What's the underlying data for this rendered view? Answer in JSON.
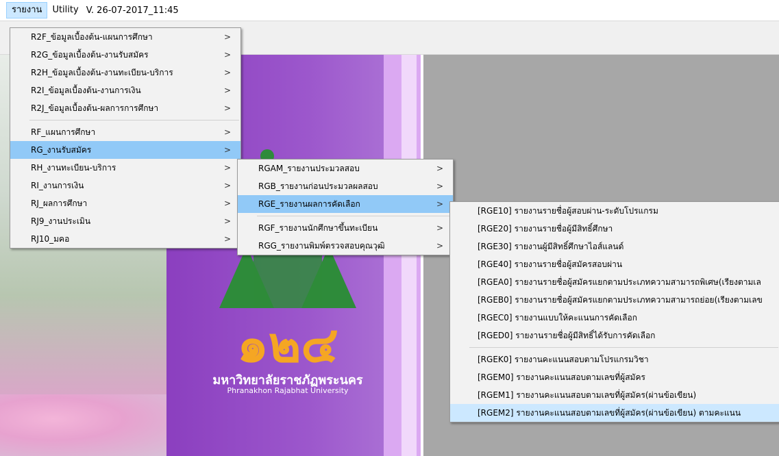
{
  "menubar": {
    "report": "รายงาน",
    "utility": "Utility",
    "version": "V. 26-07-2017_11:45"
  },
  "menu_main": {
    "group1": [
      {
        "label": "R2F_ข้อมูลเบื้องต้น-แผนการศึกษา",
        "arrow": ">"
      },
      {
        "label": "R2G_ข้อมูลเบื้องต้น-งานรับสมัคร",
        "arrow": ">"
      },
      {
        "label": "R2H_ข้อมูลเบื้องต้น-งานทะเบียน-บริการ",
        "arrow": ">"
      },
      {
        "label": "R2I_ข้อมูลเบื้องต้น-งานการเงิน",
        "arrow": ">"
      },
      {
        "label": "R2J_ข้อมูลเบื้องต้น-ผลการการศึกษา",
        "arrow": ">"
      }
    ],
    "group2": [
      {
        "label": "RF_แผนการศึกษา",
        "arrow": ">"
      },
      {
        "label": "RG_งานรับสมัคร",
        "arrow": ">"
      },
      {
        "label": "RH_งานทะเบียน-บริการ",
        "arrow": ">"
      },
      {
        "label": "RI_งานการเงิน",
        "arrow": ">"
      },
      {
        "label": "RJ_ผลการศึกษา",
        "arrow": ">"
      },
      {
        "label": "RJ9_งานประเมิน",
        "arrow": ">"
      },
      {
        "label": "RJ10_มคอ",
        "arrow": ">"
      }
    ]
  },
  "menu_rg": {
    "group1": [
      {
        "label": "RGAM_รายงานประมวลสอบ",
        "arrow": ">"
      },
      {
        "label": "RGB_รายงานก่อนประมวลผลสอบ",
        "arrow": ">"
      },
      {
        "label": "RGE_รายงานผลการคัดเลือก",
        "arrow": ">"
      }
    ],
    "group2": [
      {
        "label": "RGF_รายงานนักศึกษาขึ้นทะเบียน",
        "arrow": ">"
      },
      {
        "label": "RGG_รายงานพิมพ์ตรวจสอบคุณวุฒิ",
        "arrow": ">"
      }
    ]
  },
  "menu_rge": {
    "group1": [
      {
        "label": "[RGE10] รายงานรายชื่อผู้สอบผ่าน-ระดับโปรแกรม"
      },
      {
        "label": "[RGE20] รายงานรายชื่อผู้มีสิทธิ์ศึกษา"
      },
      {
        "label": "[RGE30] รายงานผู้มีสิทธิ์ศึกษาไอส์แลนด์"
      },
      {
        "label": "[RGE40] รายงานรายชื่อผู้สมัครสอบผ่าน"
      },
      {
        "label": "[RGEA0] รายงานรายชื่อผู้สมัครแยกตามประเภทความสามารถพิเศษ(เรียงตามเล"
      },
      {
        "label": "[RGEB0] รายงานรายชื่อผู้สมัครแยกตามประเภทความสามารถย่อย(เรียงตามเลข"
      },
      {
        "label": "[RGEC0] รายงานแบบให้คะแนนการคัดเลือก"
      },
      {
        "label": "[RGED0] รายงานรายชื่อผู้มีสิทธิ์ได้รับการคัดเลือก"
      }
    ],
    "group2": [
      {
        "label": "[RGEK0] รายงานคะแนนสอบตามโปรแกรมวิชา"
      },
      {
        "label": "[RGEM0] รายงานคะแนนสอบตามเลขที่ผู้สมัคร"
      },
      {
        "label": "[RGEM1] รายงานคะแนนสอบตามเลขที่ผู้สมัคร(ผ่านข้อเขียน)"
      },
      {
        "label": "[RGEM2] รายงานคะแนนสอบตามเลขที่ผู้สมัคร(ผ่านข้อเขียน) ตามคะแนน"
      }
    ]
  },
  "logo": {
    "numerals": "๑๒๔",
    "name_th": "มหาวิทยาลัยราชภัฏพระนคร",
    "name_en": "Phranakhon Rajabhat University"
  },
  "colors": {
    "highlight": "#91c9f7",
    "menu_bg": "#f2f2f2",
    "banner_purple": "#9c57cc",
    "logo_orange": "#f5a623"
  }
}
